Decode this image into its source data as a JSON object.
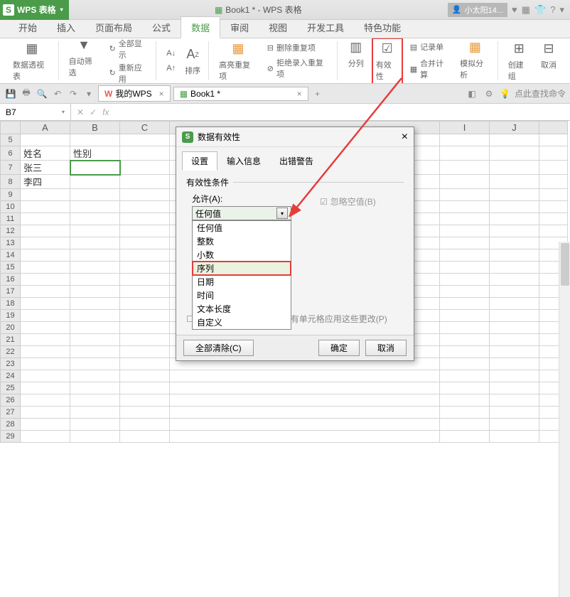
{
  "titlebar": {
    "app_name": "WPS 表格",
    "doc_title": "Book1 * - WPS 表格",
    "user_name": "小太阳14..."
  },
  "menutabs": {
    "items": [
      "开始",
      "插入",
      "页面布局",
      "公式",
      "数据",
      "审阅",
      "视图",
      "开发工具",
      "特色功能"
    ],
    "active_index": 4
  },
  "ribbon": {
    "pivot": "数据透视表",
    "autofilter": "自动筛选",
    "show_all": "全部显示",
    "reapply": "重新应用",
    "sort": "排序",
    "highlight_dup": "高亮重复项",
    "remove_dup": "删除重复项",
    "reject_dup": "拒绝录入重复项",
    "text_to_cols": "分列",
    "validity": "有效性",
    "record_form": "记录单",
    "consolidate": "合并计算",
    "whatif": "模拟分析",
    "group": "创建组",
    "ungroup": "取消"
  },
  "qat": {
    "my_wps": "我的WPS",
    "book_tab": "Book1 *",
    "search_hint": "点此查找命令"
  },
  "formula": {
    "namebox": "B7",
    "fx": "fx"
  },
  "grid": {
    "cols": [
      "A",
      "B",
      "C",
      "I",
      "J"
    ],
    "rows_start": 5,
    "rows_end": 29,
    "cells": {
      "A6": "姓名",
      "B6": "性别",
      "A7": "张三",
      "A8": "李四"
    },
    "selected": "B7"
  },
  "dialog": {
    "title": "数据有效性",
    "tabs": [
      "设置",
      "输入信息",
      "出错警告"
    ],
    "fieldset": "有效性条件",
    "allow_label": "允许(A):",
    "allow_value": "任何值",
    "options": [
      "任何值",
      "整数",
      "小数",
      "序列",
      "日期",
      "时间",
      "文本长度",
      "自定义"
    ],
    "highlight_index": 3,
    "ignore_blank": "忽略空值(B)",
    "apply_all": "对所有同样设置的其他所有单元格应用这些更改(P)",
    "clear_all": "全部清除(C)",
    "ok": "确定",
    "cancel": "取消"
  }
}
